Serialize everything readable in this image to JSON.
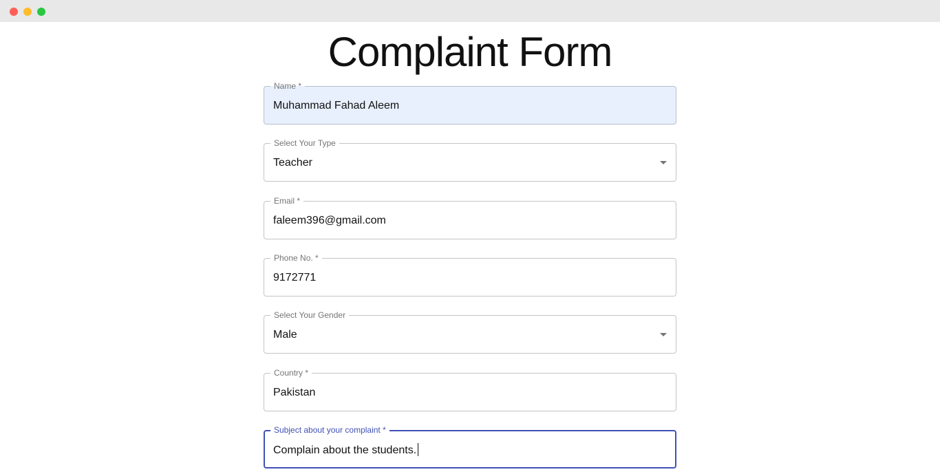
{
  "page": {
    "title": "Complaint Form"
  },
  "form": {
    "name": {
      "label": "Name *",
      "value": "Muhammad Fahad Aleem"
    },
    "type": {
      "label": "Select Your Type",
      "value": "Teacher"
    },
    "email": {
      "label": "Email *",
      "value": "faleem396@gmail.com"
    },
    "phone": {
      "label": "Phone No. *",
      "value": "9172771"
    },
    "gender": {
      "label": "Select Your Gender",
      "value": "Male"
    },
    "country": {
      "label": "Country *",
      "value": "Pakistan"
    },
    "subject": {
      "label": "Subject about your complaint *",
      "value": "Complain about the students."
    }
  },
  "colors": {
    "focus_accent": "#3f51b5",
    "autofill_background": "#e8f0fe",
    "border": "#c4c4c4"
  },
  "icons": {
    "dropdown": "arrow-drop-down"
  }
}
